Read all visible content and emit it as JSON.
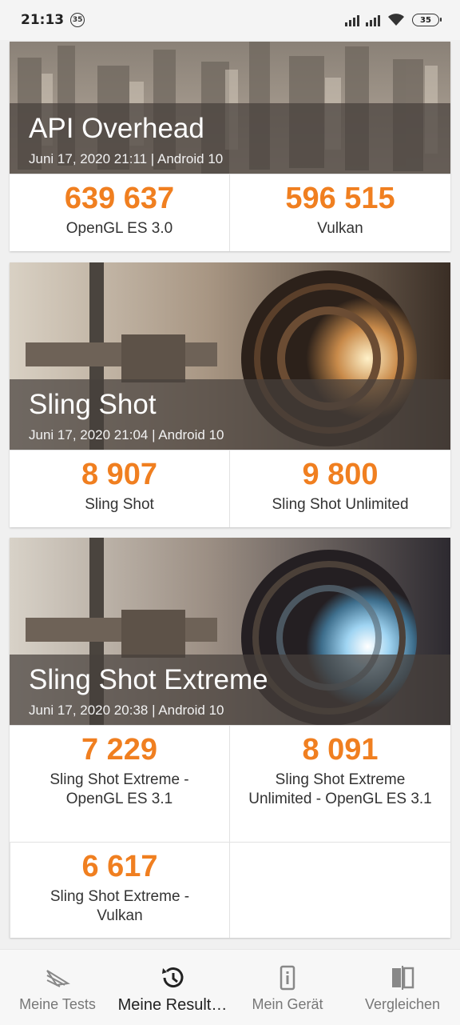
{
  "status_bar": {
    "time": "21:13",
    "notification_badge": "35",
    "battery": "35"
  },
  "cards": [
    {
      "title": "API Overhead",
      "subtitle": "Juni 17, 2020 21:11 | Android 10",
      "results": [
        {
          "score": "639 637",
          "label": "OpenGL ES 3.0"
        },
        {
          "score": "596 515",
          "label": "Vulkan"
        }
      ]
    },
    {
      "title": "Sling Shot",
      "subtitle": "Juni 17, 2020 21:04 | Android 10",
      "results": [
        {
          "score": "8 907",
          "label": "Sling Shot"
        },
        {
          "score": "9 800",
          "label": "Sling Shot Unlimited"
        }
      ]
    },
    {
      "title": "Sling Shot Extreme",
      "subtitle": "Juni 17, 2020 20:38 | Android 10",
      "results": [
        {
          "score": "7 229",
          "label": "Sling Shot Extreme - OpenGL ES 3.1"
        },
        {
          "score": "8 091",
          "label": "Sling Shot Extreme Unlimited - OpenGL ES 3.1"
        },
        {
          "score": "6 617",
          "label": "Sling Shot Extreme - Vulkan"
        }
      ]
    }
  ],
  "bottom_nav": {
    "items": [
      {
        "label": "Meine Tests",
        "icon": "3dmark-logo-icon"
      },
      {
        "label": "Meine Result…",
        "icon": "history-icon"
      },
      {
        "label": "Mein Gerät",
        "icon": "device-info-icon"
      },
      {
        "label": "Vergleichen",
        "icon": "compare-icon"
      }
    ],
    "active_index": 1
  },
  "colors": {
    "score": "#f07f20",
    "band": "#46403c"
  }
}
